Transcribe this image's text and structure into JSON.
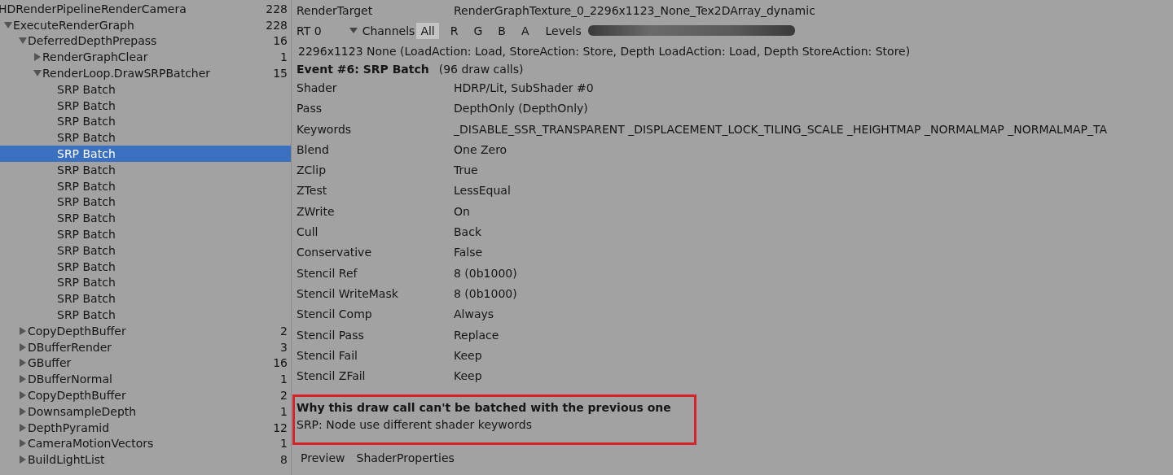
{
  "tree": [
    {
      "label": "HDRenderPipelineRenderCamera",
      "count": "228",
      "selected": false,
      "children": [
        {
          "label": "ExecuteRenderGraph",
          "count": "228",
          "expanded": true,
          "selected": false,
          "children": [
            {
              "label": "DeferredDepthPrepass",
              "count": "16",
              "expanded": true,
              "selected": false,
              "children": [
                {
                  "label": "RenderGraphClear",
                  "count": "1",
                  "expanded": false,
                  "selected": false
                },
                {
                  "label": "RenderLoop.DrawSRPBatcher",
                  "count": "15",
                  "expanded": true,
                  "selected": false,
                  "children": [
                    {
                      "label": "SRP Batch",
                      "selected": false
                    },
                    {
                      "label": "SRP Batch",
                      "selected": false
                    },
                    {
                      "label": "SRP Batch",
                      "selected": false
                    },
                    {
                      "label": "SRP Batch",
                      "selected": false
                    },
                    {
                      "label": "SRP Batch",
                      "selected": true
                    },
                    {
                      "label": "SRP Batch",
                      "selected": false
                    },
                    {
                      "label": "SRP Batch",
                      "selected": false
                    },
                    {
                      "label": "SRP Batch",
                      "selected": false
                    },
                    {
                      "label": "SRP Batch",
                      "selected": false
                    },
                    {
                      "label": "SRP Batch",
                      "selected": false
                    },
                    {
                      "label": "SRP Batch",
                      "selected": false
                    },
                    {
                      "label": "SRP Batch",
                      "selected": false
                    },
                    {
                      "label": "SRP Batch",
                      "selected": false
                    },
                    {
                      "label": "SRP Batch",
                      "selected": false
                    },
                    {
                      "label": "SRP Batch",
                      "selected": false
                    }
                  ]
                }
              ]
            },
            {
              "label": "CopyDepthBuffer",
              "count": "2",
              "expanded": false,
              "selected": false
            },
            {
              "label": "DBufferRender",
              "count": "3",
              "expanded": false,
              "selected": false
            },
            {
              "label": "GBuffer",
              "count": "16",
              "expanded": false,
              "selected": false
            },
            {
              "label": "DBufferNormal",
              "count": "1",
              "expanded": false,
              "selected": false
            },
            {
              "label": "CopyDepthBuffer",
              "count": "2",
              "expanded": false,
              "selected": false
            },
            {
              "label": "DownsampleDepth",
              "count": "1",
              "expanded": false,
              "selected": false
            },
            {
              "label": "DepthPyramid",
              "count": "12",
              "expanded": false,
              "selected": false
            },
            {
              "label": "CameraMotionVectors",
              "count": "1",
              "expanded": false,
              "selected": false
            },
            {
              "label": "BuildLightList",
              "count": "8",
              "expanded": false,
              "selected": false
            }
          ]
        }
      ]
    }
  ],
  "render_target": {
    "label": "RenderTarget",
    "value": "RenderGraphTexture_0_2296x1123_None_Tex2DArray_dynamic"
  },
  "toolbar": {
    "rt": "RT 0",
    "channels_label": "Channels",
    "channels": [
      {
        "label": "All",
        "selected": true
      },
      {
        "label": "R",
        "selected": false
      },
      {
        "label": "G",
        "selected": false
      },
      {
        "label": "B",
        "selected": false
      },
      {
        "label": "A",
        "selected": false
      }
    ],
    "levels_label": "Levels",
    "level": 1
  },
  "target_info": "2296x1123 None (LoadAction: Load, StoreAction: Store, Depth LoadAction: Load, Depth StoreAction: Store)",
  "event": {
    "title": "Event #6: SRP Batch",
    "draw_calls": "(96 draw calls)"
  },
  "properties": [
    {
      "name": "Shader",
      "value": "HDRP/Lit, SubShader #0"
    },
    {
      "name": "Pass",
      "value": "DepthOnly (DepthOnly)"
    },
    {
      "name": "Keywords",
      "value": "_DISABLE_SSR_TRANSPARENT _DISPLACEMENT_LOCK_TILING_SCALE _HEIGHTMAP _NORMALMAP _NORMALMAP_TA"
    },
    {
      "name": "Blend",
      "value": "One Zero"
    },
    {
      "name": "ZClip",
      "value": "True"
    },
    {
      "name": "ZTest",
      "value": "LessEqual"
    },
    {
      "name": "ZWrite",
      "value": "On"
    },
    {
      "name": "Cull",
      "value": "Back"
    },
    {
      "name": "Conservative",
      "value": "False"
    },
    {
      "name": "Stencil Ref",
      "value": "8 (0b1000)"
    },
    {
      "name": "Stencil WriteMask",
      "value": "8 (0b1000)"
    },
    {
      "name": "Stencil Comp",
      "value": "Always"
    },
    {
      "name": "Stencil Pass",
      "value": "Replace"
    },
    {
      "name": "Stencil Fail",
      "value": "Keep"
    },
    {
      "name": "Stencil ZFail",
      "value": "Keep"
    }
  ],
  "batch_note": {
    "title": "Why this draw call can't be batched with the previous one",
    "reason": "SRP: Node use different shader keywords"
  },
  "tabs": [
    {
      "label": "Preview",
      "selected": false
    },
    {
      "label": "ShaderProperties",
      "selected": false
    }
  ]
}
